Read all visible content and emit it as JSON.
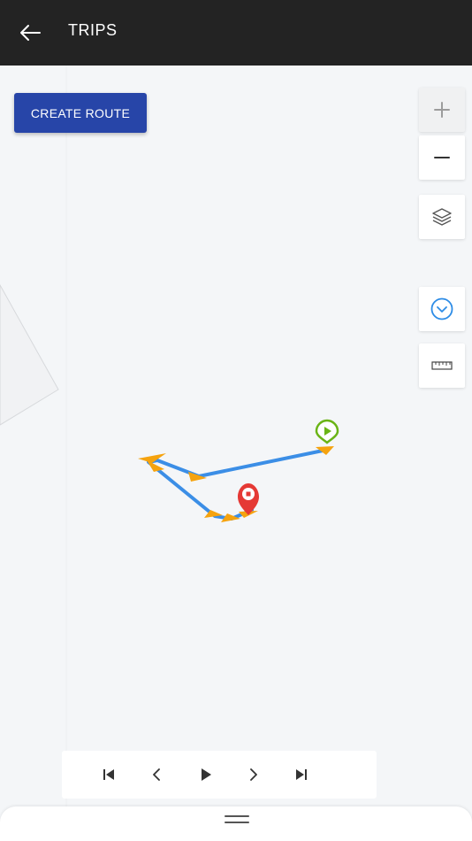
{
  "appbar": {
    "title": "TRIPS",
    "back_icon": "arrow-left-icon"
  },
  "map": {
    "create_route_label": "CREATE ROUTE",
    "controls": [
      {
        "name": "zoom-in",
        "icon": "plus-icon"
      },
      {
        "name": "zoom-out",
        "icon": "minus-icon"
      },
      {
        "name": "layers",
        "icon": "layers-icon"
      },
      {
        "name": "collapse",
        "icon": "chevron-circle-down-icon"
      },
      {
        "name": "measure",
        "icon": "ruler-icon"
      }
    ],
    "route_color": "#3b8ee6",
    "arrow_color": "#f5a30f",
    "start_marker_color": "#6ab416",
    "end_marker_color": "#e53935"
  },
  "player": {
    "buttons": [
      "skip-first-icon",
      "previous-icon",
      "play-icon",
      "next-icon",
      "skip-last-icon"
    ]
  },
  "colors": {
    "appbar": "#232323",
    "accent": "#2745a8",
    "map_background": "#f4f6f8"
  }
}
